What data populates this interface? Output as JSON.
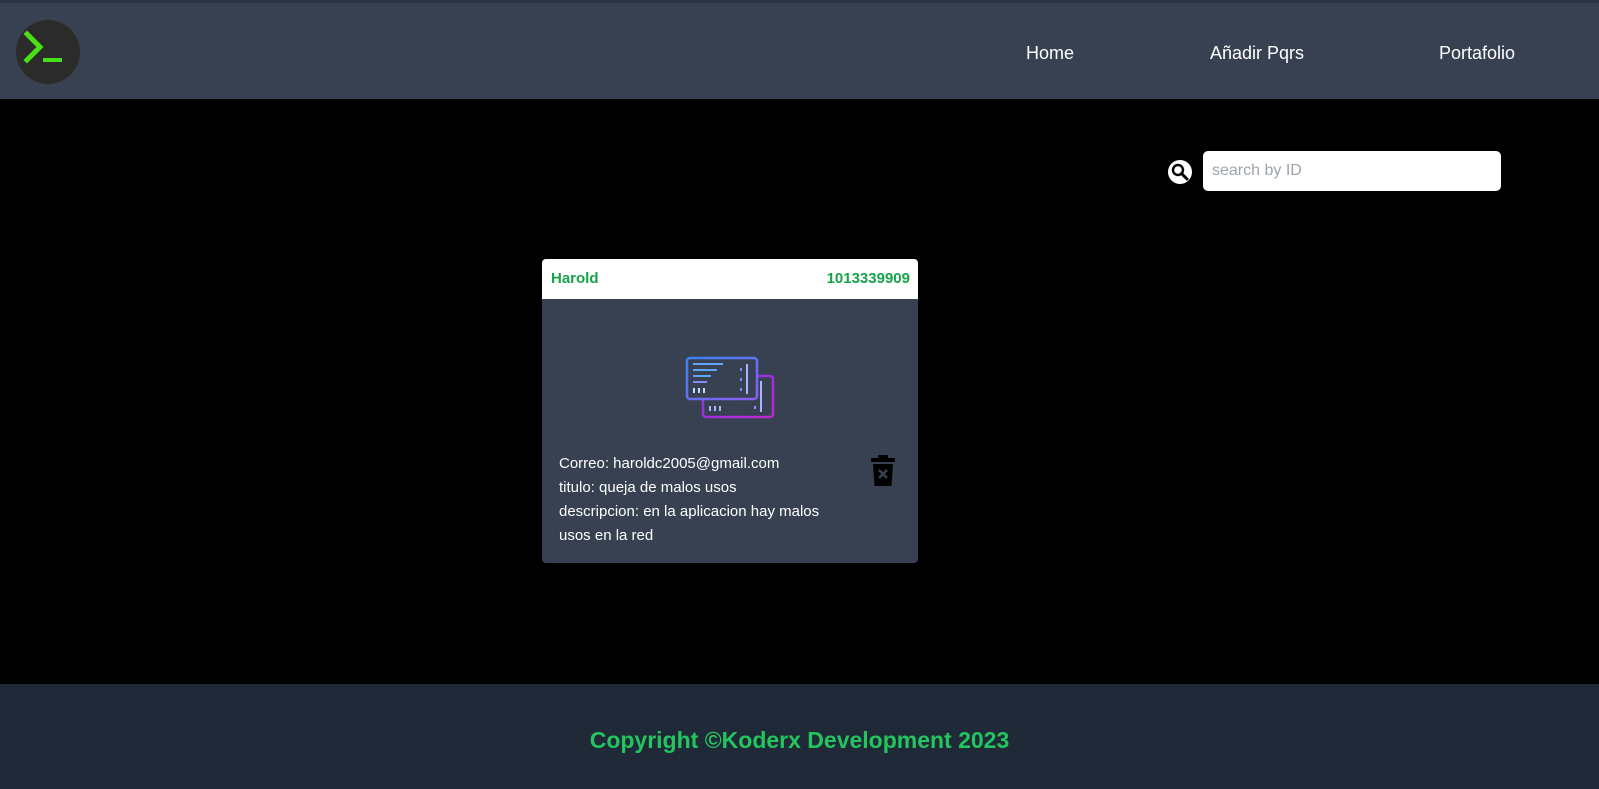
{
  "nav": {
    "home": "Home",
    "add_pqrs": "Añadir Pqrs",
    "portfolio": "Portafolio"
  },
  "search": {
    "placeholder": "search by ID",
    "value": ""
  },
  "card": {
    "name": "Harold",
    "id": "1013339909",
    "correo": "Correo: haroldc2005@gmail.com",
    "titulo": "titulo: queja de malos usos",
    "descripcion": "descripcion: en la aplicacion hay malos usos en la red"
  },
  "footer": {
    "copyright": "Copyright ©Koderx Development 2023"
  },
  "icons": {
    "logo": "terminal-prompt-icon",
    "search": "magnifier-icon",
    "ticket": "ticket-icon",
    "delete": "trash-x-icon"
  },
  "colors": {
    "accent_green": "#16a34a",
    "logo_green": "#4ade17",
    "topbar": "#374151",
    "footer": "#1f2937",
    "card": "#374151"
  }
}
